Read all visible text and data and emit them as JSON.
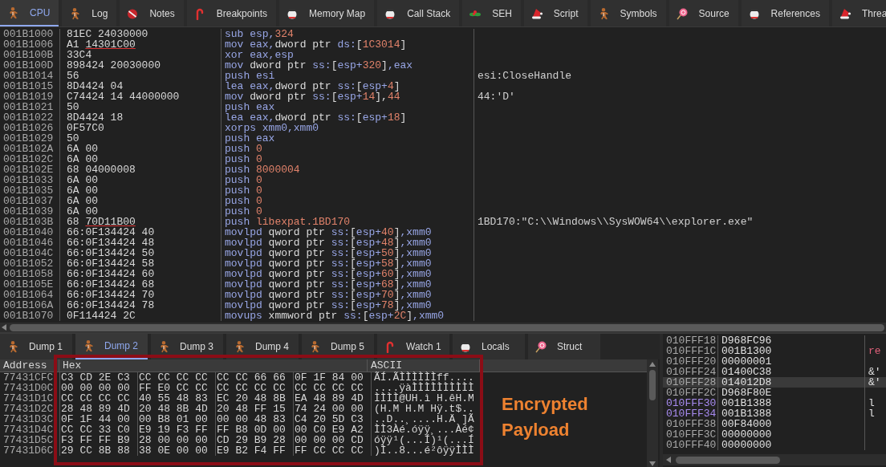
{
  "tabs": [
    {
      "label": "CPU",
      "selected": true
    },
    {
      "label": "Log",
      "selected": false
    },
    {
      "label": "Notes",
      "selected": false
    },
    {
      "label": "Breakpoints",
      "selected": false
    },
    {
      "label": "Memory Map",
      "selected": false
    },
    {
      "label": "Call Stack",
      "selected": false
    },
    {
      "label": "SEH",
      "selected": false
    },
    {
      "label": "Script",
      "selected": false
    },
    {
      "label": "Symbols",
      "selected": false
    },
    {
      "label": "Source",
      "selected": false
    },
    {
      "label": "References",
      "selected": false
    },
    {
      "label": "Threa",
      "selected": false
    }
  ],
  "disassembly": {
    "rows": [
      {
        "address": "001B1000",
        "bytes": "81EC 24030000",
        "instruction": [
          {
            "text": "sub esp,",
            "kind": "op"
          },
          {
            "text": "324",
            "kind": "num"
          }
        ]
      },
      {
        "address": "001B1006",
        "bytes": "A1 ",
        "bytes_ref": "14301C00",
        "instruction": [
          {
            "text": "mov eax,",
            "kind": "op"
          },
          {
            "text": "dword ptr ",
            "kind": "plain"
          },
          {
            "text": "ds:",
            "kind": "op"
          },
          {
            "text": "[",
            "kind": "plain"
          },
          {
            "text": "1C3014",
            "kind": "num"
          },
          {
            "text": "]",
            "kind": "plain"
          }
        ]
      },
      {
        "address": "001B100B",
        "bytes": "33C4",
        "instruction": [
          {
            "text": "xor eax,esp",
            "kind": "op"
          }
        ]
      },
      {
        "address": "001B100D",
        "bytes": "898424 20030000",
        "instruction": [
          {
            "text": "mov ",
            "kind": "op"
          },
          {
            "text": "dword ptr ",
            "kind": "plain"
          },
          {
            "text": "ss:",
            "kind": "op"
          },
          {
            "text": "[",
            "kind": "plain"
          },
          {
            "text": "esp+",
            "kind": "op"
          },
          {
            "text": "320",
            "kind": "num"
          },
          {
            "text": "]",
            "kind": "plain"
          },
          {
            "text": ",eax",
            "kind": "op"
          }
        ]
      },
      {
        "address": "001B1014",
        "bytes": "56",
        "instruction": [
          {
            "text": "push esi",
            "kind": "op"
          }
        ],
        "comment": "esi:CloseHandle"
      },
      {
        "address": "001B1015",
        "bytes": "8D4424 04",
        "instruction": [
          {
            "text": "lea eax,",
            "kind": "op"
          },
          {
            "text": "dword ptr ",
            "kind": "plain"
          },
          {
            "text": "ss:",
            "kind": "op"
          },
          {
            "text": "[",
            "kind": "plain"
          },
          {
            "text": "esp+",
            "kind": "op"
          },
          {
            "text": "4",
            "kind": "num"
          },
          {
            "text": "]",
            "kind": "plain"
          }
        ]
      },
      {
        "address": "001B1019",
        "bytes": "C74424 14 44000000",
        "instruction": [
          {
            "text": "mov ",
            "kind": "op"
          },
          {
            "text": "dword ptr ",
            "kind": "plain"
          },
          {
            "text": "ss:",
            "kind": "op"
          },
          {
            "text": "[",
            "kind": "plain"
          },
          {
            "text": "esp+",
            "kind": "op"
          },
          {
            "text": "14",
            "kind": "num"
          },
          {
            "text": "],",
            "kind": "plain"
          },
          {
            "text": "44",
            "kind": "num"
          }
        ],
        "comment": "44:'D'"
      },
      {
        "address": "001B1021",
        "bytes": "50",
        "instruction": [
          {
            "text": "push eax",
            "kind": "op"
          }
        ]
      },
      {
        "address": "001B1022",
        "bytes": "8D4424 18",
        "instruction": [
          {
            "text": "lea eax,",
            "kind": "op"
          },
          {
            "text": "dword ptr ",
            "kind": "plain"
          },
          {
            "text": "ss:",
            "kind": "op"
          },
          {
            "text": "[",
            "kind": "plain"
          },
          {
            "text": "esp+",
            "kind": "op"
          },
          {
            "text": "18",
            "kind": "num"
          },
          {
            "text": "]",
            "kind": "plain"
          }
        ]
      },
      {
        "address": "001B1026",
        "bytes": "0F57C0",
        "instruction": [
          {
            "text": "xorps xmm0,xmm0",
            "kind": "op"
          }
        ]
      },
      {
        "address": "001B1029",
        "bytes": "50",
        "instruction": [
          {
            "text": "push eax",
            "kind": "op"
          }
        ]
      },
      {
        "address": "001B102A",
        "bytes": "6A 00",
        "instruction": [
          {
            "text": "push ",
            "kind": "op"
          },
          {
            "text": "0",
            "kind": "num"
          }
        ]
      },
      {
        "address": "001B102C",
        "bytes": "6A 00",
        "instruction": [
          {
            "text": "push ",
            "kind": "op"
          },
          {
            "text": "0",
            "kind": "num"
          }
        ]
      },
      {
        "address": "001B102E",
        "bytes": "68 04000008",
        "instruction": [
          {
            "text": "push ",
            "kind": "op"
          },
          {
            "text": "8000004",
            "kind": "num"
          }
        ]
      },
      {
        "address": "001B1033",
        "bytes": "6A 00",
        "instruction": [
          {
            "text": "push ",
            "kind": "op"
          },
          {
            "text": "0",
            "kind": "num"
          }
        ]
      },
      {
        "address": "001B1035",
        "bytes": "6A 00",
        "instruction": [
          {
            "text": "push ",
            "kind": "op"
          },
          {
            "text": "0",
            "kind": "num"
          }
        ]
      },
      {
        "address": "001B1037",
        "bytes": "6A 00",
        "instruction": [
          {
            "text": "push ",
            "kind": "op"
          },
          {
            "text": "0",
            "kind": "num"
          }
        ]
      },
      {
        "address": "001B1039",
        "bytes": "6A 00",
        "instruction": [
          {
            "text": "push ",
            "kind": "op"
          },
          {
            "text": "0",
            "kind": "num"
          }
        ]
      },
      {
        "address": "001B103B",
        "bytes": "68 ",
        "bytes_ref": "70D11B00",
        "instruction": [
          {
            "text": "push ",
            "kind": "op"
          },
          {
            "text": "libexpat.1BD170",
            "kind": "num"
          }
        ],
        "comment": "1BD170:\"C:\\\\Windows\\\\SysWOW64\\\\explorer.exe\""
      },
      {
        "address": "001B1040",
        "bytes": "66:0F134424 40",
        "instruction": [
          {
            "text": "movlpd ",
            "kind": "op"
          },
          {
            "text": "qword ptr ",
            "kind": "plain"
          },
          {
            "text": "ss:",
            "kind": "op"
          },
          {
            "text": "[",
            "kind": "plain"
          },
          {
            "text": "esp+",
            "kind": "op"
          },
          {
            "text": "40",
            "kind": "num"
          },
          {
            "text": "]",
            "kind": "plain"
          },
          {
            "text": ",xmm0",
            "kind": "op"
          }
        ]
      },
      {
        "address": "001B1046",
        "bytes": "66:0F134424 48",
        "instruction": [
          {
            "text": "movlpd ",
            "kind": "op"
          },
          {
            "text": "qword ptr ",
            "kind": "plain"
          },
          {
            "text": "ss:",
            "kind": "op"
          },
          {
            "text": "[",
            "kind": "plain"
          },
          {
            "text": "esp+",
            "kind": "op"
          },
          {
            "text": "48",
            "kind": "num"
          },
          {
            "text": "]",
            "kind": "plain"
          },
          {
            "text": ",xmm0",
            "kind": "op"
          }
        ]
      },
      {
        "address": "001B104C",
        "bytes": "66:0F134424 50",
        "instruction": [
          {
            "text": "movlpd ",
            "kind": "op"
          },
          {
            "text": "qword ptr ",
            "kind": "plain"
          },
          {
            "text": "ss:",
            "kind": "op"
          },
          {
            "text": "[",
            "kind": "plain"
          },
          {
            "text": "esp+",
            "kind": "op"
          },
          {
            "text": "50",
            "kind": "num"
          },
          {
            "text": "]",
            "kind": "plain"
          },
          {
            "text": ",xmm0",
            "kind": "op"
          }
        ]
      },
      {
        "address": "001B1052",
        "bytes": "66:0F134424 58",
        "instruction": [
          {
            "text": "movlpd ",
            "kind": "op"
          },
          {
            "text": "qword ptr ",
            "kind": "plain"
          },
          {
            "text": "ss:",
            "kind": "op"
          },
          {
            "text": "[",
            "kind": "plain"
          },
          {
            "text": "esp+",
            "kind": "op"
          },
          {
            "text": "58",
            "kind": "num"
          },
          {
            "text": "]",
            "kind": "plain"
          },
          {
            "text": ",xmm0",
            "kind": "op"
          }
        ]
      },
      {
        "address": "001B1058",
        "bytes": "66:0F134424 60",
        "instruction": [
          {
            "text": "movlpd ",
            "kind": "op"
          },
          {
            "text": "qword ptr ",
            "kind": "plain"
          },
          {
            "text": "ss:",
            "kind": "op"
          },
          {
            "text": "[",
            "kind": "plain"
          },
          {
            "text": "esp+",
            "kind": "op"
          },
          {
            "text": "60",
            "kind": "num"
          },
          {
            "text": "]",
            "kind": "plain"
          },
          {
            "text": ",xmm0",
            "kind": "op"
          }
        ]
      },
      {
        "address": "001B105E",
        "bytes": "66:0F134424 68",
        "instruction": [
          {
            "text": "movlpd ",
            "kind": "op"
          },
          {
            "text": "qword ptr ",
            "kind": "plain"
          },
          {
            "text": "ss:",
            "kind": "op"
          },
          {
            "text": "[",
            "kind": "plain"
          },
          {
            "text": "esp+",
            "kind": "op"
          },
          {
            "text": "68",
            "kind": "num"
          },
          {
            "text": "]",
            "kind": "plain"
          },
          {
            "text": ",xmm0",
            "kind": "op"
          }
        ]
      },
      {
        "address": "001B1064",
        "bytes": "66:0F134424 70",
        "instruction": [
          {
            "text": "movlpd ",
            "kind": "op"
          },
          {
            "text": "qword ptr ",
            "kind": "plain"
          },
          {
            "text": "ss:",
            "kind": "op"
          },
          {
            "text": "[",
            "kind": "plain"
          },
          {
            "text": "esp+",
            "kind": "op"
          },
          {
            "text": "70",
            "kind": "num"
          },
          {
            "text": "]",
            "kind": "plain"
          },
          {
            "text": ",xmm0",
            "kind": "op"
          }
        ]
      },
      {
        "address": "001B106A",
        "bytes": "66:0F134424 78",
        "instruction": [
          {
            "text": "movlpd ",
            "kind": "op"
          },
          {
            "text": "qword ptr ",
            "kind": "plain"
          },
          {
            "text": "ss:",
            "kind": "op"
          },
          {
            "text": "[",
            "kind": "plain"
          },
          {
            "text": "esp+",
            "kind": "op"
          },
          {
            "text": "78",
            "kind": "num"
          },
          {
            "text": "]",
            "kind": "plain"
          },
          {
            "text": ",xmm0",
            "kind": "op"
          }
        ]
      },
      {
        "address": "001B1070",
        "bytes": "0F114424 2C",
        "instruction": [
          {
            "text": "movups ",
            "kind": "op"
          },
          {
            "text": "xmmword ptr ",
            "kind": "plain"
          },
          {
            "text": "ss:",
            "kind": "op"
          },
          {
            "text": "[",
            "kind": "plain"
          },
          {
            "text": "esp+",
            "kind": "op"
          },
          {
            "text": "2C",
            "kind": "num"
          },
          {
            "text": "]",
            "kind": "plain"
          },
          {
            "text": ",xmm0",
            "kind": "op"
          }
        ]
      }
    ]
  },
  "dump_tabs": [
    {
      "label": "Dump 1",
      "selected": false
    },
    {
      "label": "Dump 2",
      "selected": true
    },
    {
      "label": "Dump 3",
      "selected": false
    },
    {
      "label": "Dump 4",
      "selected": false
    },
    {
      "label": "Dump 5",
      "selected": false
    },
    {
      "label": "Watch 1",
      "selected": false
    },
    {
      "label": "Locals",
      "selected": false
    },
    {
      "label": "Struct",
      "selected": false
    }
  ],
  "dump": {
    "columns": [
      "Address",
      "Hex",
      "ASCII"
    ],
    "rows": [
      {
        "address": "77431CFC",
        "hex": [
          "C3 CD 2E C3",
          "CC CC CC CC",
          "CC CC 66 66",
          "0F 1F 84 00"
        ],
        "ascii": "ÃÍ.ÃÌÌÌÌÌÌff...."
      },
      {
        "address": "77431D0C",
        "hex": [
          "00 00 00 00",
          "FF E0 CC CC",
          "CC CC CC CC",
          "CC CC CC CC"
        ],
        "ascii": "....ÿàÌÌÌÌÌÌÌÌÌÌ"
      },
      {
        "address": "77431D1C",
        "hex": [
          "CC CC CC CC",
          "40 55 48 83",
          "EC 20 48 8B",
          "EA 48 89 4D"
        ],
        "ascii": "ÌÌÌÌ@UH.ì H.êH.M"
      },
      {
        "address": "77431D2C",
        "hex": [
          "28 48 89 4D",
          "20 48 8B 4D",
          "20 48 FF 15",
          "74 24 00 00"
        ],
        "ascii": "(H.M H.M Hÿ.t$.."
      },
      {
        "address": "77431D3C",
        "hex": [
          "0F 1F 44 00",
          "00 B8 01 00",
          "00 00 48 83",
          "C4 20 5D C3"
        ],
        "ascii": "..D..¸....H.Ä ]Ã"
      },
      {
        "address": "77431D4C",
        "hex": [
          "CC CC 33 C0",
          "E9 19 F3 FF",
          "FF B8 0D 00",
          "00 C0 E9 A2"
        ],
        "ascii": "ÌÌ3Àé.óÿÿ¸...Àé¢"
      },
      {
        "address": "77431D5C",
        "hex": [
          "F3 FF FF B9",
          "28 00 00 00",
          "CD 29 B9 28",
          "00 00 00 CD"
        ],
        "ascii": "óÿÿ¹(...Í)¹(...Í"
      },
      {
        "address": "77431D6C",
        "hex": [
          "29 CC 8B 88",
          "38 0E 00 00",
          "E9 B2 F4 FF",
          "FF CC CC CC"
        ],
        "ascii": ")Ì..8...é²ôÿÿÌÌÌ"
      }
    ]
  },
  "annotation": {
    "text": "Encrypted Payload"
  },
  "stack": {
    "rows": [
      {
        "address": "010FFF18",
        "value": "D968FC96",
        "selected": false,
        "marked": false
      },
      {
        "address": "010FFF1C",
        "value": "001B1300",
        "comment": "re",
        "color": "#e0607a",
        "selected": false,
        "marked": false
      },
      {
        "address": "010FFF20",
        "value": "00000001",
        "selected": false,
        "marked": false
      },
      {
        "address": "010FFF24",
        "value": "01400C38",
        "comment": "&'",
        "color": "#e0e0e0",
        "selected": false,
        "marked": false
      },
      {
        "address": "010FFF28",
        "value": "014012D8",
        "comment": "&'",
        "color": "#e0e0e0",
        "selected": true,
        "marked": false
      },
      {
        "address": "010FFF2C",
        "value": "D968F80E",
        "selected": false,
        "marked": false
      },
      {
        "address": "010FFF30",
        "value": "001B1388",
        "comment": "l",
        "color": "#e0e0e0",
        "selected": false,
        "marked": true
      },
      {
        "address": "010FFF34",
        "value": "001B1388",
        "comment": "l",
        "color": "#e0e0e0",
        "selected": false,
        "marked": true
      },
      {
        "address": "010FFF38",
        "value": "00F84000",
        "selected": false,
        "marked": false
      },
      {
        "address": "010FFF3C",
        "value": "00000000",
        "selected": false,
        "marked": false
      },
      {
        "address": "010FFF40",
        "value": "00000000",
        "selected": false,
        "marked": false
      }
    ]
  }
}
